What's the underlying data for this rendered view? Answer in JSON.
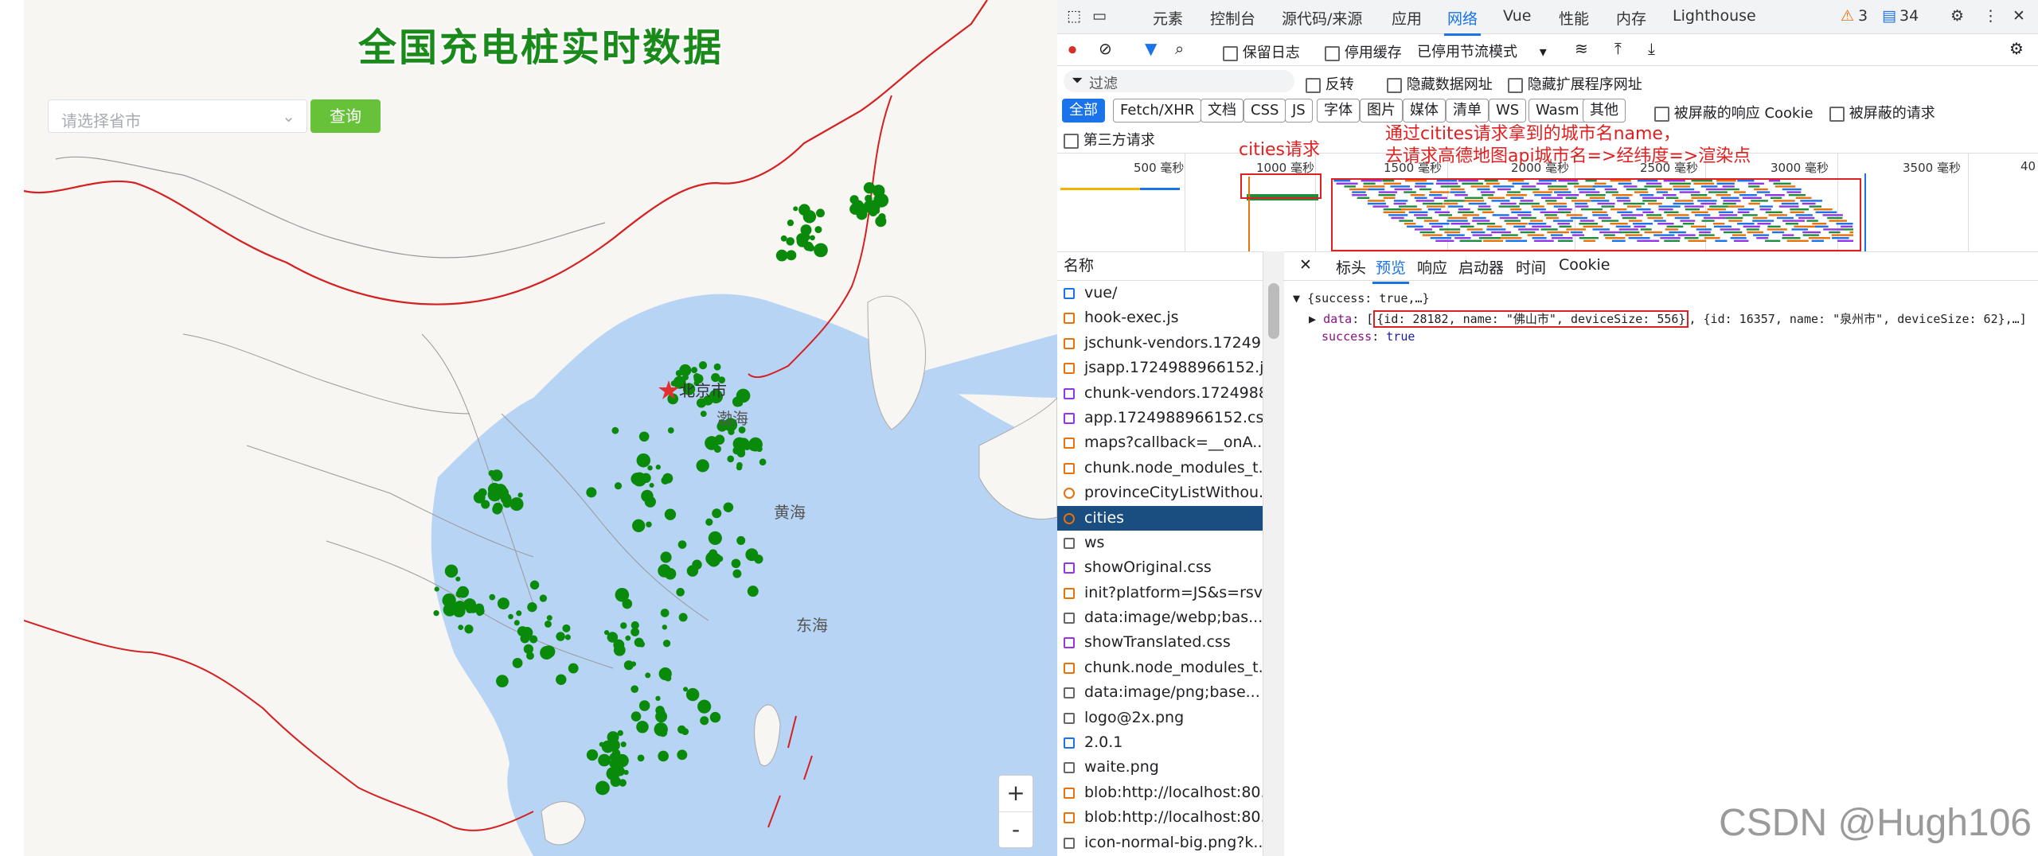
{
  "map": {
    "title": "全国充电桩实时数据",
    "select_placeholder": "请选择省市",
    "query_button": "查询",
    "city_label": "北京市",
    "sea_labels": [
      "渤海",
      "黄海",
      "东海"
    ],
    "zoom_in": "+",
    "zoom_out": "-"
  },
  "devtools": {
    "tabs": [
      "元素",
      "控制台",
      "源代码/来源",
      "应用",
      "网络",
      "Vue",
      "性能",
      "内存",
      "Lighthouse"
    ],
    "active_tab": "网络",
    "warnings": "3",
    "messages": "34",
    "toolbar": {
      "preserve_log": "保留日志",
      "disable_cache": "停用缓存",
      "throttle": "已停用节流模式"
    },
    "filter": {
      "placeholder": "过滤",
      "invert": "反转",
      "hide_data_urls": "隐藏数据网址",
      "hide_ext_urls": "隐藏扩展程序网址",
      "types": [
        "全部",
        "Fetch/XHR",
        "文档",
        "CSS",
        "JS",
        "字体",
        "图片",
        "媒体",
        "清单",
        "WS",
        "Wasm",
        "其他"
      ],
      "blocked_cookies": "被屏蔽的响应 Cookie",
      "blocked_requests": "被屏蔽的请求",
      "third_party": "第三方请求"
    },
    "timeline_ticks": [
      "500 毫秒",
      "1000 毫秒",
      "1500 毫秒",
      "2000 毫秒",
      "2500 毫秒",
      "3000 毫秒",
      "3500 毫秒",
      "40"
    ],
    "annotations": {
      "cities_request": "cities请求",
      "note_line1": "通过citites请求拿到的城市名name，",
      "note_line2": "去请求高德地图api城市名=>经纬度=>渲染点"
    },
    "list_header": "名称",
    "requests": [
      "vue/",
      "hook-exec.js",
      "jschunk-vendors.17249...",
      "jsapp.1724988966152.js",
      "chunk-vendors.1724988...",
      "app.1724988966152.css",
      "maps?callback=__onA...",
      "chunk.node_modules_t...",
      "provinceCityListWithou...",
      "cities",
      "ws",
      "showOriginal.css",
      "init?platform=JS&s=rsv...",
      "data:image/webp;bas...",
      "showTranslated.css",
      "chunk.node_modules_t...",
      "data:image/png;base...",
      "logo@2x.png",
      "2.0.1",
      "waite.png",
      "blob:http://localhost:80...",
      "blob:http://localhost:80...",
      "icon-normal-big.png?k..."
    ],
    "selected_request": "cities",
    "detail_tabs": [
      "标头",
      "预览",
      "响应",
      "启动器",
      "时间",
      "Cookie"
    ],
    "active_detail_tab": "预览",
    "preview": {
      "root": "{success: true,…}",
      "data_key": "data",
      "data_value_highlight": "{id: 28182, name: \"佛山市\", deviceSize: 556}",
      "data_value_rest": ", {id: 16357, name: \"泉州市\", deviceSize: 62},…]",
      "success_key": "success",
      "success_value": "true"
    }
  },
  "watermark": "CSDN @Hugh106"
}
